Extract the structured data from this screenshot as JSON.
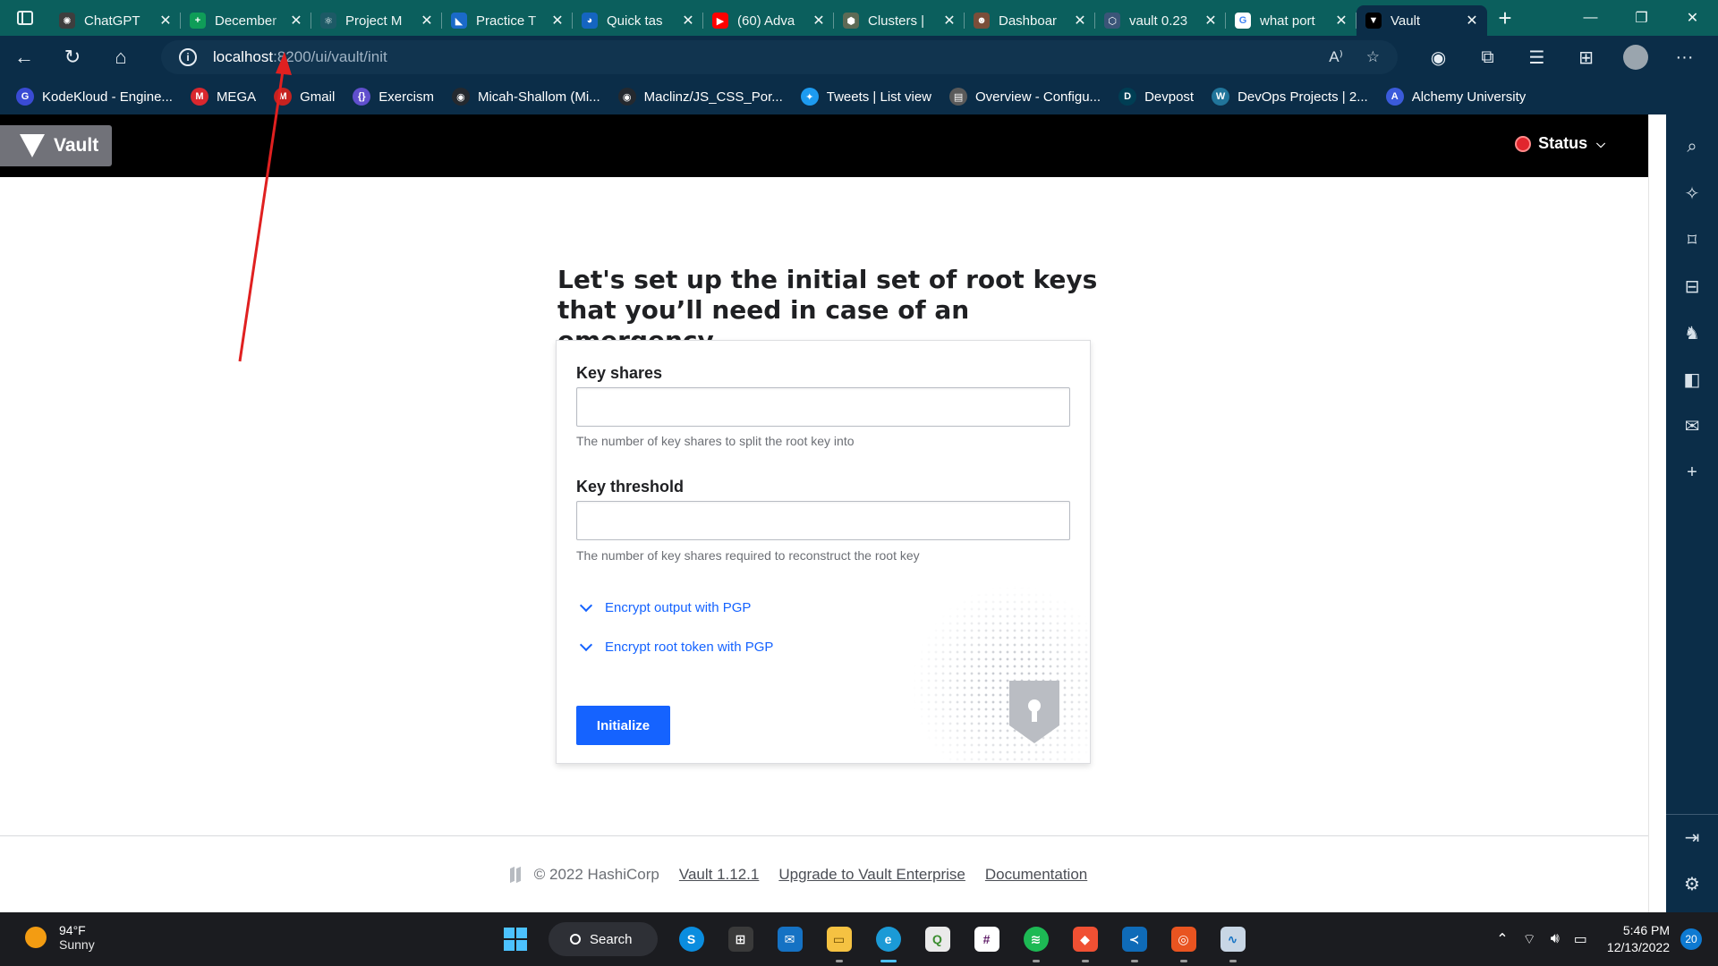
{
  "browser": {
    "tabs": [
      {
        "title": "ChatGPT",
        "color": "#3e3e3e",
        "glyph": "✺"
      },
      {
        "title": "December",
        "color": "#0f9d58",
        "glyph": "+"
      },
      {
        "title": "Project M",
        "color": "#1d5a66",
        "glyph": "⚛"
      },
      {
        "title": "Practice T",
        "color": "#1b6ac9",
        "glyph": "◣"
      },
      {
        "title": "Quick tas",
        "color": "#1565c0",
        "glyph": "◕"
      },
      {
        "title": "(60) Adva",
        "color": "#ff0000",
        "glyph": "▶"
      },
      {
        "title": "Clusters |",
        "color": "#5d6a55",
        "glyph": "⬢"
      },
      {
        "title": "Dashboar",
        "color": "#7a4e3a",
        "glyph": "☻"
      },
      {
        "title": "vault 0.23",
        "color": "#3a5578",
        "glyph": "⬡"
      },
      {
        "title": "what port",
        "color": "#ffffff",
        "glyph": "G"
      },
      {
        "title": "Vault",
        "color": "#000000",
        "glyph": "▼"
      }
    ],
    "active_tab_index": 10,
    "url_host": "localhost",
    "url_path": ":8200/ui/vault/init",
    "bookmarks": [
      {
        "label": "KodeKloud - Engine...",
        "color": "#3a4bd4",
        "glyph": "G"
      },
      {
        "label": "MEGA",
        "color": "#d9272e",
        "glyph": "M"
      },
      {
        "label": "Gmail",
        "color": "#c5221f",
        "glyph": "M"
      },
      {
        "label": "Exercism",
        "color": "#604fcd",
        "glyph": "{}"
      },
      {
        "label": "Micah-Shallom (Mi...",
        "color": "#24292f",
        "glyph": "◉"
      },
      {
        "label": "Maclinz/JS_CSS_Por...",
        "color": "#24292f",
        "glyph": "◉"
      },
      {
        "label": "Tweets | List view",
        "color": "#1d9bf0",
        "glyph": "✦"
      },
      {
        "label": "Overview - Configu...",
        "color": "#5a5a5a",
        "glyph": "▤"
      },
      {
        "label": "Devpost",
        "color": "#003e54",
        "glyph": "D"
      },
      {
        "label": "DevOps Projects | 2...",
        "color": "#21759b",
        "glyph": "W"
      },
      {
        "label": "Alchemy University",
        "color": "#3b5bdb",
        "glyph": "A"
      }
    ]
  },
  "app": {
    "brand": "Vault",
    "status_label": "Status",
    "status_color": "#e1262d",
    "heading": "Let's set up the initial set of root keys that you’ll need in case of an emergency",
    "form": {
      "key_shares_label": "Key shares",
      "key_shares_value": "",
      "key_shares_help": "The number of key shares to split the root key into",
      "key_threshold_label": "Key threshold",
      "key_threshold_value": "",
      "key_threshold_help": "The number of key shares required to reconstruct the root key",
      "pgp_output_label": "Encrypt output with PGP",
      "pgp_root_label": "Encrypt root token with PGP",
      "submit_label": "Initialize"
    },
    "accent_color": "#1563ff",
    "footer": {
      "copyright": "© 2022 HashiCorp",
      "version": "Vault 1.12.1",
      "upgrade": "Upgrade to Vault Enterprise",
      "docs": "Documentation"
    }
  },
  "taskbar": {
    "weather_temp": "94°F",
    "weather_desc": "Sunny",
    "search_label": "Search",
    "time": "5:46 PM",
    "date": "12/13/2022",
    "notifications": "20"
  }
}
